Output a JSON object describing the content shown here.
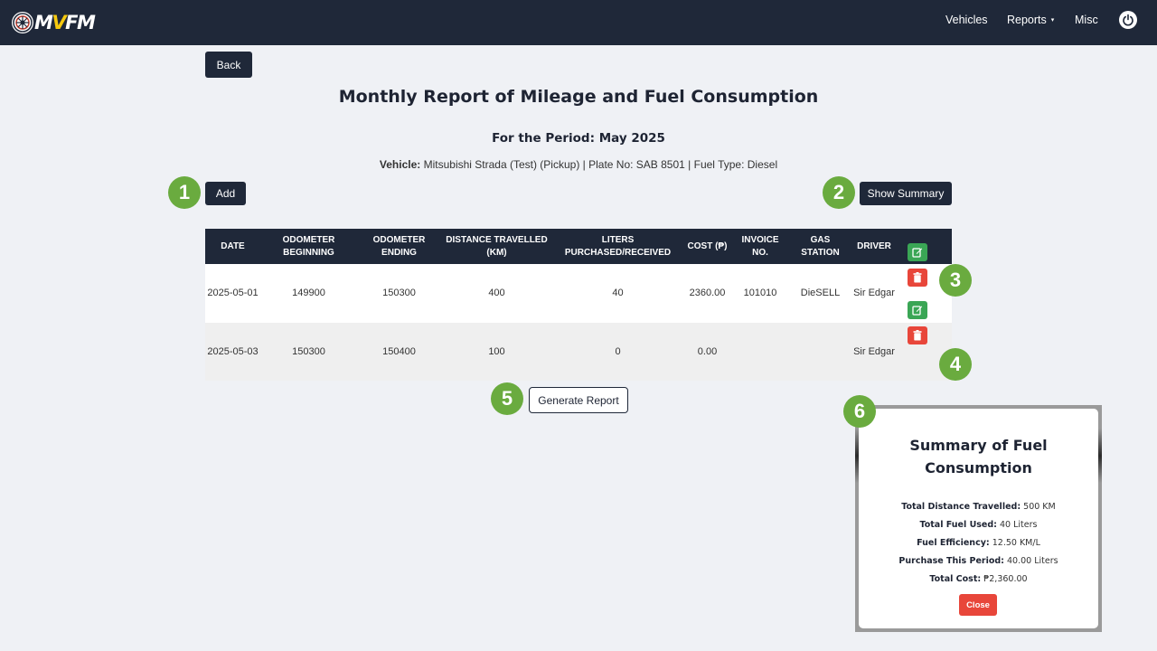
{
  "navbar": {
    "logo_prefix": "M",
    "logo_accent": "V",
    "logo_suffix": "FM",
    "items": {
      "vehicles": "Vehicles",
      "reports": "Reports",
      "misc": "Misc"
    },
    "reports_caret": "▾",
    "power_icon": "power-icon"
  },
  "actions": {
    "back": "Back",
    "add": "Add",
    "show_summary": "Show Summary",
    "generate_report": "Generate Report"
  },
  "report": {
    "title": "Monthly Report of Mileage and Fuel Consumption",
    "period": "For the Period: May 2025",
    "vehicle_label": "Vehicle:",
    "vehicle_info": "Mitsubishi Strada (Test) (Pickup) | Plate No: SAB 8501 | Fuel Type: Diesel"
  },
  "table": {
    "headers": {
      "date": "DATE",
      "odo_begin": "ODOMETER BEGINNING",
      "odo_end": "ODOMETER ENDING",
      "distance": "DISTANCE TRAVELLED (KM)",
      "liters": "LITERS PURCHASED/RECEIVED",
      "cost": "COST (₱)",
      "invoice": "INVOICE NO.",
      "station": "GAS STATION",
      "driver": "DRIVER"
    },
    "rows": [
      {
        "date": "2025-05-01",
        "odo_begin": "149900",
        "odo_end": "150300",
        "distance": "400",
        "liters": "40",
        "cost": "2360.00",
        "invoice": "101010",
        "station": "DieSELL",
        "driver": "Sir Edgar"
      },
      {
        "date": "2025-05-03",
        "odo_begin": "150300",
        "odo_end": "150400",
        "distance": "100",
        "liters": "0",
        "cost": "0.00",
        "invoice": "",
        "station": "",
        "driver": "Sir Edgar"
      }
    ]
  },
  "badges": {
    "b1": "1",
    "b2": "2",
    "b3": "3",
    "b4": "4",
    "b5": "5",
    "b6": "6"
  },
  "summary": {
    "title": "Summary of Fuel Consumption",
    "distance_label": "Total Distance Travelled:",
    "distance_value": "500 KM",
    "fuel_label": "Total Fuel Used:",
    "fuel_value": "40 Liters",
    "efficiency_label": "Fuel Efficiency:",
    "efficiency_value": "12.50 KM/L",
    "purchase_label": "Purchase This Period:",
    "purchase_value": "40.00 Liters",
    "cost_label": "Total Cost:",
    "cost_value": "₱2,360.00",
    "close": "Close"
  },
  "colors": {
    "navbar": "#1f2839",
    "badge": "#6aab3f",
    "edit": "#3aa655",
    "delete": "#e8463a",
    "logo_accent": "#f6c90e"
  }
}
